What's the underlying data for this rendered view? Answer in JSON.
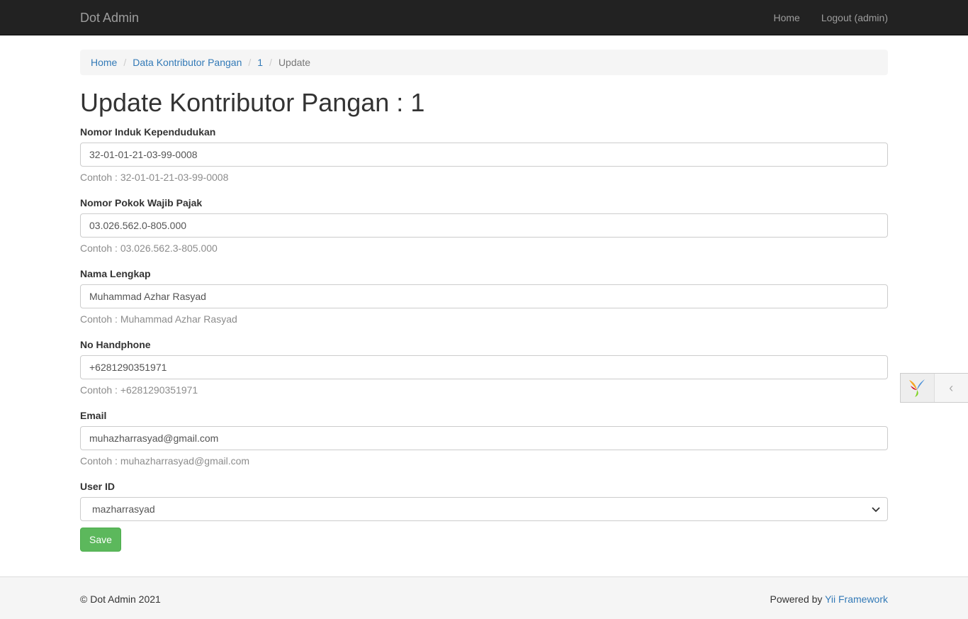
{
  "navbar": {
    "brand": "Dot Admin",
    "links": [
      "Home",
      "Logout (admin)"
    ]
  },
  "breadcrumb": {
    "items": [
      "Home",
      "Data Kontributor Pangan",
      "1"
    ],
    "active": "Update",
    "separator": "/"
  },
  "page_title": "Update Kontributor Pangan : 1",
  "form": {
    "fields": [
      {
        "label": "Nomor Induk Kependudukan",
        "value": "32-01-01-21-03-99-0008",
        "hint": "Contoh : 32-01-01-21-03-99-0008"
      },
      {
        "label": "Nomor Pokok Wajib Pajak",
        "value": "03.026.562.0-805.000",
        "hint": "Contoh : 03.026.562.3-805.000"
      },
      {
        "label": "Nama Lengkap",
        "value": "Muhammad Azhar Rasyad",
        "hint": "Contoh : Muhammad Azhar Rasyad"
      },
      {
        "label": "No Handphone",
        "value": "+6281290351971",
        "hint": "Contoh : +6281290351971"
      },
      {
        "label": "Email",
        "value": "muhazharrasyad@gmail.com",
        "hint": "Contoh : muhazharrasyad@gmail.com"
      }
    ],
    "user_id": {
      "label": "User ID",
      "selected": "mazharrasyad"
    },
    "save_label": "Save"
  },
  "footer": {
    "copyright": "© Dot Admin 2021",
    "powered_prefix": "Powered by",
    "powered_link": "Yii Framework"
  },
  "colors": {
    "navbar_bg": "#222222",
    "link": "#337ab7",
    "save_button": "#5cb85c",
    "hint_text": "#8c8c8c"
  },
  "icons": [
    "yii-logo-icon",
    "chevron-left-icon",
    "chevron-down-icon"
  ]
}
